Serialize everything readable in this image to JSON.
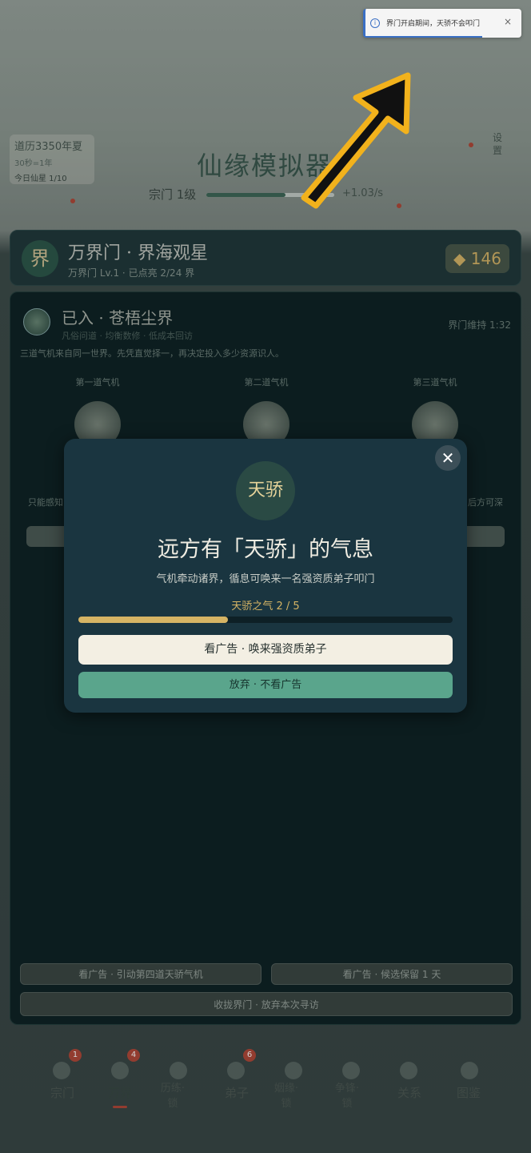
{
  "toast": {
    "message": "界门开启期间，天骄不会叩门",
    "close": "×"
  },
  "header": {
    "calendar_year": "道历3350年夏",
    "calendar_rate": "30秒=1年",
    "calendar_today": "今日仙星 1/10",
    "game_title": "仙缘模拟器",
    "settings_label": "设置",
    "sect_label": "宗门 1级",
    "sect_rate": "+1.03/s",
    "sect_progress": 0.62
  },
  "realm": {
    "emblem": "界",
    "title": "万界门 · 界海观星",
    "subtitle": "万界门 Lv.1 · 已点亮 2/24 界",
    "gems": "◆ 146"
  },
  "panel": {
    "entered_title": "已入 · 苍梧尘界",
    "entered_sub": "凡俗问道 · 均衡数修 · 低成本回访",
    "keep_time": "界门维持 1:32",
    "intro": "三道气机来自同一世界。先凭直觉择一，再决定投入多少资源识人。",
    "qi": [
      {
        "label": "第一道气机"
      },
      {
        "label": "第二道气机"
      },
      {
        "label": "第三道气机"
      }
    ],
    "side_left": "只能感知",
    "side_right": "后方可深",
    "btn_lure": "看广告 · 引动第四道天骄气机",
    "btn_keep": "看广告 · 候选保留 1 天",
    "btn_close": "收拢界门 · 放弃本次寻访"
  },
  "nav": {
    "items": [
      {
        "label": "宗门",
        "badge": "1"
      },
      {
        "label": "万界",
        "badge": "4"
      },
      {
        "label": "历练·\n锁",
        "badge": ""
      },
      {
        "label": "弟子",
        "badge": "6"
      },
      {
        "label": "姻缘·\n锁",
        "badge": ""
      },
      {
        "label": "争锋·\n锁",
        "badge": ""
      },
      {
        "label": "关系",
        "badge": ""
      },
      {
        "label": "图鉴",
        "badge": ""
      }
    ]
  },
  "modal": {
    "emblem": "天骄",
    "title": "远方有「天骄」的气息",
    "desc": "气机牵动诸界，循息可唤来一名强资质弟子叩门",
    "progress_label": "天骄之气 2 / 5",
    "progress_value": 2,
    "progress_max": 5,
    "btn_watch": "看广告 · 唤来强资质弟子",
    "btn_giveup": "放弃 · 不看广告",
    "close": "✕"
  },
  "colors": {
    "accent_gold": "#d6b464",
    "accent_green": "#5aa58c",
    "badge_red": "#b34a3a",
    "toast_blue": "#3a6fc4"
  }
}
